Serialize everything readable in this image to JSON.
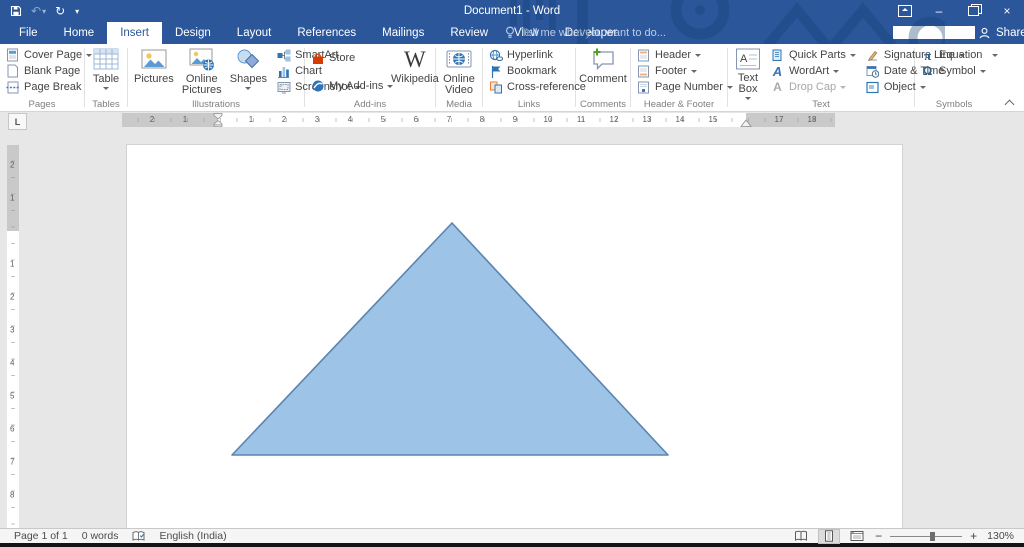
{
  "titlebar": {
    "title": "Document1 - Word"
  },
  "tabs": {
    "active": "Insert",
    "items": [
      "File",
      "Home",
      "Insert",
      "Design",
      "Layout",
      "References",
      "Mailings",
      "Review",
      "View",
      "Developer"
    ],
    "tell_me": "Tell me what you want to do...",
    "share_label": "Share",
    "search_value": ""
  },
  "ribbon": {
    "pages": {
      "label": "Pages",
      "cover_page": "Cover Page",
      "blank_page": "Blank Page",
      "page_break": "Page Break"
    },
    "tables": {
      "label": "Tables",
      "table": "Table"
    },
    "illustrations": {
      "label": "Illustrations",
      "pictures": "Pictures",
      "online_pictures": "Online Pictures",
      "shapes": "Shapes",
      "smartart": "SmartArt",
      "chart": "Chart",
      "screenshot": "Screenshot"
    },
    "addins": {
      "label": "Add-ins",
      "store": "Store",
      "my_addins": "My Add-ins",
      "wikipedia": "Wikipedia"
    },
    "media": {
      "label": "Media",
      "online_video": "Online Video"
    },
    "links": {
      "label": "Links",
      "hyperlink": "Hyperlink",
      "bookmark": "Bookmark",
      "cross_reference": "Cross-reference"
    },
    "comments": {
      "label": "Comments",
      "comment": "Comment"
    },
    "header_footer": {
      "label": "Header & Footer",
      "header": "Header",
      "footer": "Footer",
      "page_number": "Page Number"
    },
    "text": {
      "label": "Text",
      "text_box": "Text Box",
      "quick_parts": "Quick Parts",
      "wordart": "WordArt",
      "drop_cap": "Drop Cap",
      "signature_line": "Signature Line",
      "date_time": "Date & Time",
      "object": "Object"
    },
    "symbols": {
      "label": "Symbols",
      "equation": "Equation",
      "symbol": "Symbol"
    }
  },
  "icons": {
    "undo": "↶",
    "redo": "↻",
    "qat_more": "▾",
    "undo_dd": "▾",
    "minimize": "–",
    "close": "×",
    "wikipedia_w": "W",
    "pi": "π",
    "omega": "Ω",
    "wordart_letter": "A",
    "dropcap_letter": "A",
    "textbox_letter": "A",
    "signature_pen": "✎",
    "tab_selector": "L",
    "zoom_out": "−",
    "zoom_in": "+"
  },
  "ruler": {
    "left_numbers": [
      "2",
      "1"
    ],
    "body_numbers": [
      "1",
      "2",
      "3",
      "4",
      "5",
      "6",
      "7",
      "8",
      "9",
      "10",
      "11",
      "12",
      "13",
      "14",
      "15"
    ],
    "right_numbers": [
      "17",
      "18"
    ],
    "v_top_numbers": [
      "2",
      "1"
    ],
    "v_body_numbers": [
      "1",
      "2",
      "3",
      "4",
      "5",
      "6",
      "7",
      "8"
    ]
  },
  "document": {
    "shape": {
      "type": "isosceles triangle",
      "fill": "#9DC3E6",
      "stroke": "#5B84B1"
    }
  },
  "statusbar": {
    "page_info": "Page 1 of 1",
    "word_count": "0 words",
    "language": "English (India)",
    "zoom_level": "130%"
  },
  "colors": {
    "titlebar_blue": "#2B579A",
    "shape_fill": "#9DC3E6",
    "shape_stroke": "#5B84B1"
  }
}
